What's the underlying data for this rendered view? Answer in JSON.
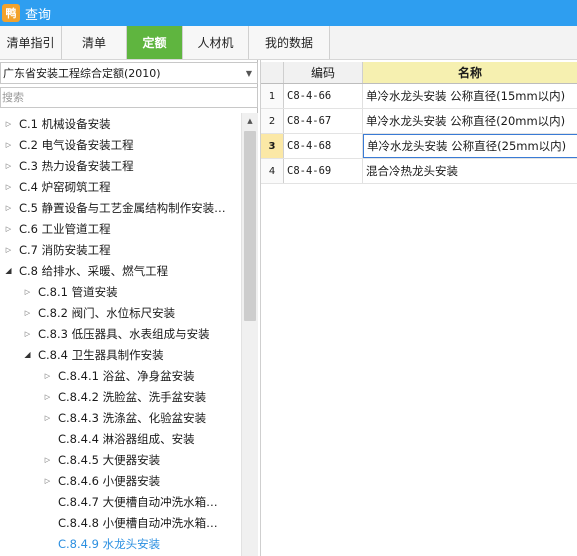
{
  "window": {
    "title": "查询",
    "icon_glyph": "鸭"
  },
  "tabs": [
    {
      "label": "清单指引",
      "active": false
    },
    {
      "label": "清单",
      "active": false
    },
    {
      "label": "定额",
      "active": true
    },
    {
      "label": "人材机",
      "active": false
    },
    {
      "label": "我的数据",
      "active": false
    }
  ],
  "left": {
    "library_select": "广东省安装工程综合定额(2010)",
    "search_placeholder": "搜索",
    "tree": [
      {
        "label": "C.1 机械设备安装",
        "state": "closed"
      },
      {
        "label": "C.2 电气设备安装工程",
        "state": "closed"
      },
      {
        "label": "C.3 热力设备安装工程",
        "state": "closed"
      },
      {
        "label": "C.4 炉窑砌筑工程",
        "state": "closed"
      },
      {
        "label": "C.5 静置设备与工艺金属结构制作安装…",
        "state": "closed"
      },
      {
        "label": "C.6 工业管道工程",
        "state": "closed"
      },
      {
        "label": "C.7 消防安装工程",
        "state": "closed"
      },
      {
        "label": "C.8 给排水、采暖、燃气工程",
        "state": "open"
      },
      {
        "label": "C.8.1 管道安装",
        "state": "closed"
      },
      {
        "label": "C.8.2 阀门、水位标尺安装",
        "state": "closed"
      },
      {
        "label": "C.8.3 低压器具、水表组成与安装",
        "state": "closed"
      },
      {
        "label": "C.8.4 卫生器具制作安装",
        "state": "open"
      },
      {
        "label": "C.8.4.1 浴盆、净身盆安装",
        "state": "closed"
      },
      {
        "label": "C.8.4.2 洗脸盆、洗手盆安装",
        "state": "closed"
      },
      {
        "label": "C.8.4.3 洗涤盆、化验盆安装",
        "state": "closed"
      },
      {
        "label": "C.8.4.4 淋浴器组成、安装",
        "state": "leaf"
      },
      {
        "label": "C.8.4.5 大便器安装",
        "state": "closed"
      },
      {
        "label": "C.8.4.6 小便器安装",
        "state": "closed"
      },
      {
        "label": "C.8.4.7 大便槽自动冲洗水箱…",
        "state": "leaf"
      },
      {
        "label": "C.8.4.8 小便槽自动冲洗水箱…",
        "state": "leaf"
      },
      {
        "label": "C.8.4.9 水龙头安装",
        "state": "leaf",
        "selected": true
      }
    ]
  },
  "grid": {
    "columns": {
      "code": "编码",
      "name": "名称"
    },
    "rows": [
      {
        "idx": "1",
        "code": "C8-4-66",
        "name": "单冷水龙头安装 公称直径(15mm以内)",
        "selected": false
      },
      {
        "idx": "2",
        "code": "C8-4-67",
        "name": "单冷水龙头安装 公称直径(20mm以内)",
        "selected": false
      },
      {
        "idx": "3",
        "code": "C8-4-68",
        "name": "单冷水龙头安装 公称直径(25mm以内)",
        "selected": true
      },
      {
        "idx": "4",
        "code": "C8-4-69",
        "name": "混合冷热龙头安装",
        "selected": false
      }
    ]
  },
  "colors": {
    "titlebar": "#2e9ef0",
    "active_tab": "#5fb53f",
    "selected_tree_text": "#2b8fe0",
    "name_header": "#f6f0b0",
    "selected_row_index": "#fbe8a6"
  }
}
